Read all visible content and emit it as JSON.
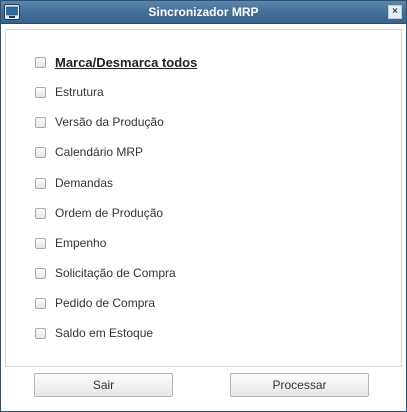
{
  "window": {
    "title": "Sincronizador MRP",
    "close_symbol": "×"
  },
  "options": [
    {
      "label": "Marca/Desmarca todos",
      "checked": false
    },
    {
      "label": "Estrutura",
      "checked": false
    },
    {
      "label": "Versão da Produção",
      "checked": false
    },
    {
      "label": "Calendário MRP",
      "checked": false
    },
    {
      "label": "Demandas",
      "checked": false
    },
    {
      "label": "Ordem de Produção",
      "checked": false
    },
    {
      "label": "Empenho",
      "checked": false
    },
    {
      "label": "Solicitação de Compra",
      "checked": false
    },
    {
      "label": "Pedido de Compra",
      "checked": false
    },
    {
      "label": "Saldo em Estoque",
      "checked": false
    }
  ],
  "buttons": {
    "exit_label": "Sair",
    "process_label": "Processar"
  },
  "icons": {
    "app": "window-app-icon",
    "close": "close-icon"
  },
  "colors": {
    "titlebar": "#44719a",
    "title_text": "#ffffff"
  }
}
